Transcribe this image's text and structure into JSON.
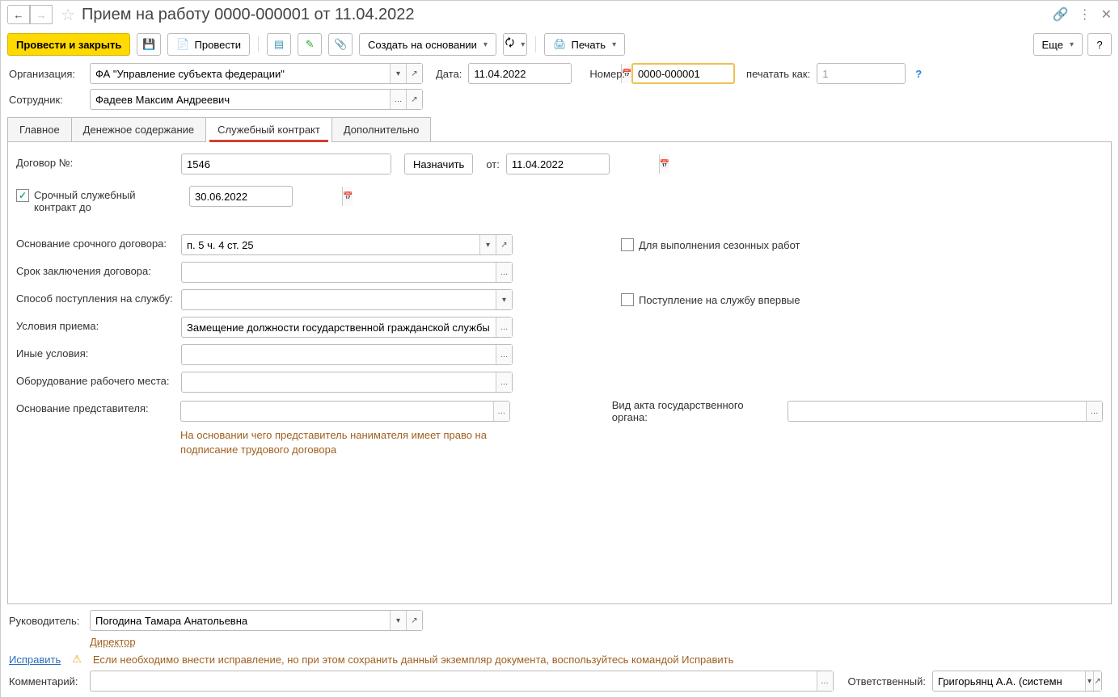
{
  "title": "Прием на работу 0000-000001 от 11.04.2022",
  "toolbar": {
    "post_close": "Провести и закрыть",
    "post": "Провести",
    "create_on_basis": "Создать на основании",
    "print": "Печать",
    "more": "Еще",
    "help": "?"
  },
  "header": {
    "org_label": "Организация:",
    "org_value": "ФА \"Управление субъекта федерации\"",
    "date_label": "Дата:",
    "date_value": "11.04.2022",
    "number_label": "Номер:",
    "number_value": "0000-000001",
    "print_as_label": "печатать как:",
    "print_as_value": "1",
    "employee_label": "Сотрудник:",
    "employee_value": "Фадеев Максим Андреевич"
  },
  "tabs": [
    "Главное",
    "Денежное содержание",
    "Служебный контракт",
    "Дополнительно"
  ],
  "contract": {
    "num_label": "Договор №:",
    "num_value": "1546",
    "assign": "Назначить",
    "from_label": "от:",
    "from_value": "11.04.2022",
    "urgent_label": "Срочный служебный контракт до",
    "urgent_date": "30.06.2022",
    "basis_label": "Основание срочного договора:",
    "basis_value": "п. 5 ч. 4 ст. 25",
    "seasonal_label": "Для выполнения сезонных работ",
    "term_label": "Срок заключения договора:",
    "entry_method_label": "Способ поступления на службу:",
    "first_time_label": "Поступление на службу впервые",
    "conditions_label": "Условия приема:",
    "conditions_value": "Замещение должности государственной гражданской службы",
    "other_conditions_label": "Иные условия:",
    "workplace_label": "Оборудование рабочего места:",
    "rep_basis_label": "Основание представителя:",
    "rep_hint": "На основании чего представитель нанимателя имеет право на подписание трудового договора",
    "act_type_label": "Вид акта государственного органа:"
  },
  "footer": {
    "manager_label": "Руководитель:",
    "manager_value": "Погодина Тамара Анатольевна",
    "manager_position": "Директор",
    "fix_link": "Исправить",
    "fix_warn": "Если необходимо внести исправление, но при этом сохранить данный экземпляр документа, воспользуйтесь командой Исправить",
    "comment_label": "Комментарий:",
    "responsible_label": "Ответственный:",
    "responsible_value": "Григорьянц А.А. (системн"
  }
}
